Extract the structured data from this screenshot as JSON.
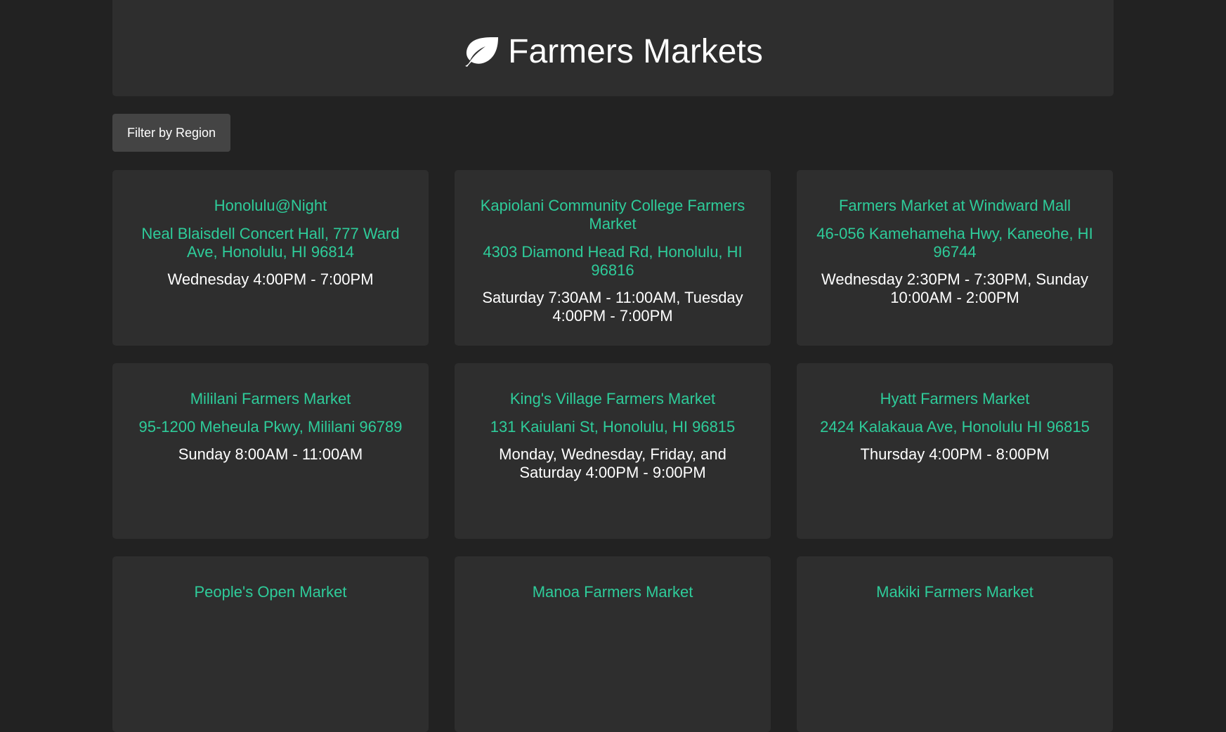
{
  "header": {
    "icon": "leaf-icon",
    "title": "Farmers Markets"
  },
  "filter": {
    "label": "Filter by Region"
  },
  "colors": {
    "background": "#222222",
    "panel": "#2e2e2e",
    "accent": "#2ecc9a",
    "button": "#444444"
  },
  "markets": [
    {
      "name": "Honolulu@Night",
      "address": "Neal Blaisdell Concert Hall, 777 Ward Ave, Honolulu, HI 96814",
      "hours": "Wednesday 4:00PM - 7:00PM"
    },
    {
      "name": "Kapiolani Community College Farmers Market",
      "address": "4303 Diamond Head Rd, Honolulu, HI 96816",
      "hours": "Saturday 7:30AM - 11:00AM, Tuesday 4:00PM - 7:00PM"
    },
    {
      "name": "Farmers Market at Windward Mall",
      "address": "46-056 Kamehameha Hwy, Kaneohe, HI 96744",
      "hours": "Wednesday 2:30PM - 7:30PM, Sunday 10:00AM - 2:00PM"
    },
    {
      "name": "Mililani Farmers Market",
      "address": "95-1200 Meheula Pkwy, Mililani 96789",
      "hours": "Sunday 8:00AM - 11:00AM"
    },
    {
      "name": "King's Village Farmers Market",
      "address": "131 Kaiulani St, Honolulu, HI 96815",
      "hours": "Monday, Wednesday, Friday, and Saturday 4:00PM - 9:00PM"
    },
    {
      "name": "Hyatt Farmers Market",
      "address": "2424 Kalakaua Ave, Honolulu HI 96815",
      "hours": "Thursday 4:00PM - 8:00PM"
    },
    {
      "name": "People's Open Market",
      "address": "",
      "hours": ""
    },
    {
      "name": "Manoa Farmers Market",
      "address": "",
      "hours": ""
    },
    {
      "name": "Makiki Farmers Market",
      "address": "",
      "hours": ""
    }
  ]
}
